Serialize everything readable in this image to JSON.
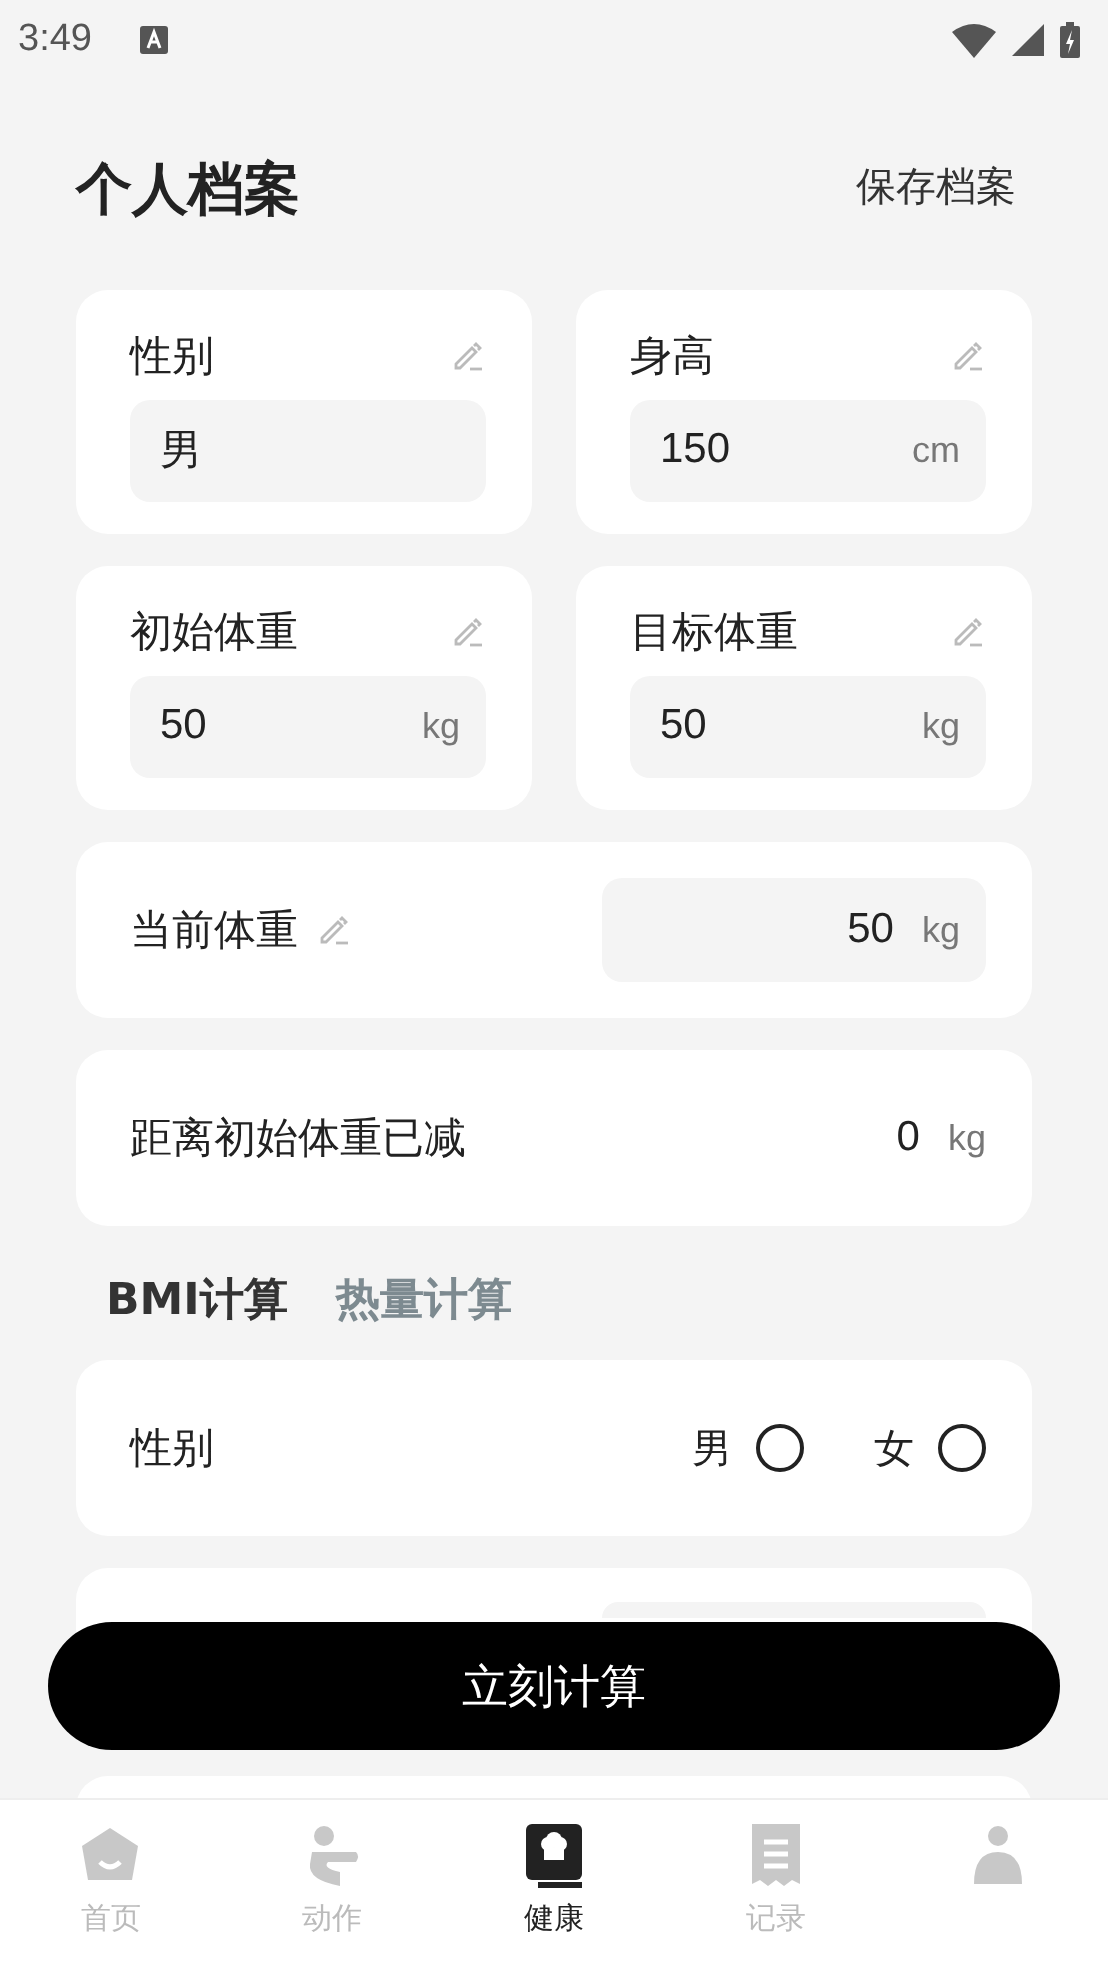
{
  "status_bar": {
    "time": "3:49"
  },
  "header": {
    "title": "个人档案",
    "save": "保存档案"
  },
  "profile_fields": [
    {
      "label": "性别",
      "value": "男"
    },
    {
      "label": "身高",
      "value": "150",
      "unit": "cm"
    },
    {
      "label": "初始体重",
      "value": "50",
      "unit": "kg"
    },
    {
      "label": "目标体重",
      "value": "50",
      "unit": "kg"
    }
  ],
  "current_weight": {
    "label": "当前体重",
    "value": "50",
    "unit": "kg"
  },
  "weight_lost": {
    "label": "距离初始体重已减",
    "value": "0",
    "unit": "kg"
  },
  "calc_tabs": [
    {
      "label": "BMI计算",
      "selected": true
    },
    {
      "label": "热量计算",
      "selected": false
    }
  ],
  "gender": {
    "label": "性别",
    "options": [
      {
        "label": "男",
        "selected": false
      },
      {
        "label": "女",
        "selected": false
      }
    ]
  },
  "calculate_button": "立刻计算",
  "nav": [
    {
      "label": "首页",
      "kind": "home",
      "selected": false
    },
    {
      "label": "动作",
      "kind": "exercise",
      "selected": false
    },
    {
      "label": "健康",
      "kind": "book",
      "selected": true
    },
    {
      "label": "记录",
      "kind": "receipt",
      "selected": false
    },
    {
      "kind": "profile",
      "selected": false
    }
  ]
}
